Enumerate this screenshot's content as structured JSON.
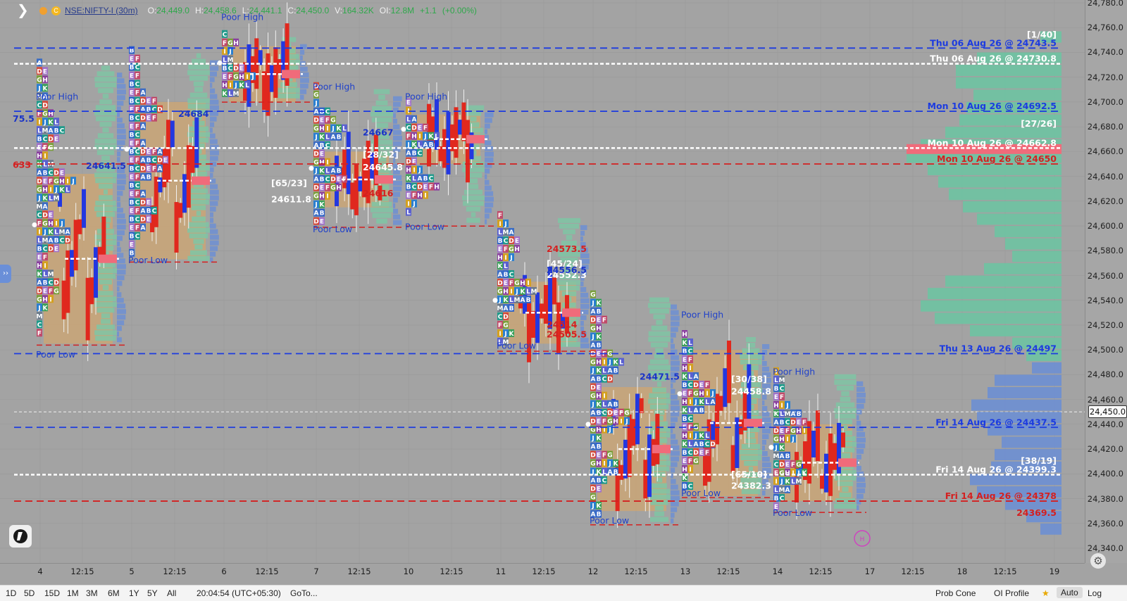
{
  "header": {
    "symbol": "NSE:NIFTY-I (30m)",
    "ohlc": [
      {
        "k": "O:",
        "v": "24,449.0"
      },
      {
        "k": "H:",
        "v": "24,458.6"
      },
      {
        "k": "L:",
        "v": "24,441.1"
      },
      {
        "k": "C:",
        "v": "24,450.0"
      },
      {
        "k": "V:",
        "v": "164.32K"
      },
      {
        "k": "OI:",
        "v": "12.8M"
      },
      {
        "k": "",
        "v": "+1.1"
      },
      {
        "k": "",
        "v": "(+0.00%)"
      }
    ]
  },
  "price_axis": {
    "ticks": [
      "24,780.0",
      "24,760.0",
      "24,740.0",
      "24,720.0",
      "24,700.0",
      "24,680.0",
      "24,660.0",
      "24,640.0",
      "24,620.0",
      "24,600.0",
      "24,580.0",
      "24,560.0",
      "24,540.0",
      "24,520.0",
      "24,500.0",
      "24,480.0",
      "24,460.0",
      "24,440.0",
      "24,420.0",
      "24,400.0",
      "24,380.0",
      "24,360.0",
      "24,340.0"
    ],
    "last_price": "24,450.0"
  },
  "time_axis": {
    "labels": [
      "4",
      "12:15",
      "5",
      "12:15",
      "6",
      "12:15",
      "7",
      "12:15",
      "10",
      "12:15",
      "11",
      "12:15",
      "12",
      "12:15",
      "13",
      "12:15",
      "14",
      "12:15",
      "17",
      "12:15",
      "18",
      "12:15",
      "19"
    ]
  },
  "bottom_bar": {
    "ranges": [
      "1D",
      "5D",
      "15D",
      "1M",
      "3M",
      "6M",
      "1Y",
      "5Y",
      "All"
    ],
    "clock": "20:04:54 (UTC+05:30)",
    "goto": "GoTo...",
    "right": [
      "Prob Cone",
      "OI Profile"
    ],
    "auto": "Auto",
    "log": "Log"
  },
  "chart_data": {
    "type": "other",
    "description_free": true,
    "y_range": [
      24340,
      24780
    ],
    "ref_lines": [
      {
        "label": "Thu 06 Aug 26 @ 24743.5",
        "price": 24743.5,
        "color": "#1c3be0",
        "style": "dash"
      },
      {
        "label": "Thu 06 Aug 26 @ 24730.8",
        "price": 24730.8,
        "color": "#ffffff",
        "style": "dot"
      },
      {
        "label": "Mon 10 Aug 26 @ 24692.5",
        "price": 24692.5,
        "color": "#1c3be0",
        "style": "dash"
      },
      {
        "label": "Mon 10 Aug 26 @ 24662.8",
        "price": 24662.8,
        "color": "#ffffff",
        "style": "dot"
      },
      {
        "label": "Mon 10 Aug 26 @ 24650",
        "price": 24650,
        "color": "#d42020",
        "style": "dash"
      },
      {
        "label": "Thu 13 Aug 26 @ 24497",
        "price": 24497,
        "color": "#1c3be0",
        "style": "dash"
      },
      {
        "label": "Fri 14 Aug 26 @ 24437.5",
        "price": 24437.5,
        "color": "#1c3be0",
        "style": "dash"
      },
      {
        "label": "Fri 14 Aug 26 @ 24399.3",
        "price": 24399.3,
        "color": "#ffffff",
        "style": "dot"
      },
      {
        "label": "Fri 14 Aug 26 @ 24378",
        "price": 24378,
        "color": "#d42020",
        "style": "dash"
      }
    ],
    "tags": [
      "[1/40]",
      "[27/26]",
      "[38/19]"
    ],
    "side_price": "24369.5",
    "annotations": [
      {
        "t": "Poor High",
        "price": 24702,
        "day": 0,
        "color": "#2142c9"
      },
      {
        "t": "Poor Low",
        "price": 24494,
        "day": 0,
        "color": "#2142c9"
      },
      {
        "t": "24641.5",
        "price": 24646,
        "day": 0,
        "color": "#1a34c8"
      },
      {
        "t": "24684",
        "price": 24688,
        "day": 1,
        "color": "#1a34c8"
      },
      {
        "t": "Poor Low",
        "price": 24570,
        "day": 1,
        "color": "#2142c9"
      },
      {
        "t": "Poor High",
        "price": 24766,
        "day": 2,
        "color": "#2142c9"
      },
      {
        "t": "[65/23]",
        "price": 24632,
        "day": 2,
        "color": "#ffffff"
      },
      {
        "t": "24611.8",
        "price": 24619,
        "day": 2,
        "color": "#ffffff"
      },
      {
        "t": "Poor High",
        "price": 24710,
        "day": 3,
        "color": "#2142c9"
      },
      {
        "t": "Poor Low",
        "price": 24595,
        "day": 3,
        "color": "#2142c9"
      },
      {
        "t": "24667",
        "price": 24673,
        "day": 3,
        "color": "#1a34c8"
      },
      {
        "t": "[28/32]",
        "price": 24655,
        "day": 3,
        "color": "#ffffff"
      },
      {
        "t": "24645.8",
        "price": 24645,
        "day": 3,
        "color": "#ffffff"
      },
      {
        "t": "24616",
        "price": 24624,
        "day": 3,
        "color": "#d42020"
      },
      {
        "t": "Poor High",
        "price": 24702,
        "day": 4,
        "color": "#2142c9"
      },
      {
        "t": "Poor Low",
        "price": 24597,
        "day": 4,
        "color": "#2142c9"
      },
      {
        "t": "24573.5",
        "price": 24579,
        "day": 5,
        "color": "#d42020"
      },
      {
        "t": "[45/24]",
        "price": 24567,
        "day": 5,
        "color": "#ffffff"
      },
      {
        "t": "24552.3",
        "price": 24558,
        "day": 5,
        "color": "#ffffff"
      },
      {
        "t": "24556.5",
        "price": 24562,
        "day": 5,
        "color": "#1a34c8"
      },
      {
        "t": "Poor Low",
        "price": 24501,
        "day": 5,
        "color": "#2142c9"
      },
      {
        "t": "24514",
        "price": 24518,
        "day": 5,
        "color": "#d42020"
      },
      {
        "t": "24505.5",
        "price": 24510,
        "day": 5,
        "color": "#d42020"
      },
      {
        "t": "24471.5",
        "price": 24476,
        "day": 6,
        "color": "#1a34c8"
      },
      {
        "t": "Poor Low",
        "price": 24360,
        "day": 6,
        "color": "#2142c9"
      },
      {
        "t": "Poor High",
        "price": 24526,
        "day": 7,
        "color": "#2142c9"
      },
      {
        "t": "[30/38]",
        "price": 24474,
        "day": 7,
        "color": "#ffffff"
      },
      {
        "t": "24458.8",
        "price": 24464,
        "day": 7,
        "color": "#ffffff"
      },
      {
        "t": "[65/10]",
        "price": 24397,
        "day": 7,
        "color": "#ffffff"
      },
      {
        "t": "24382.3",
        "price": 24388,
        "day": 7,
        "color": "#ffffff"
      },
      {
        "t": "Poor Low",
        "price": 24382,
        "day": 7,
        "color": "#2142c9"
      },
      {
        "t": "Poor High",
        "price": 24480,
        "day": 8,
        "color": "#2142c9"
      },
      {
        "t": "Poor Low",
        "price": 24366,
        "day": 8,
        "color": "#2142c9"
      },
      {
        "t": "75.5",
        "price": 24684,
        "day": -1,
        "color": "#1a34c8"
      },
      {
        "t": "633",
        "price": 24647,
        "day": -1,
        "color": "#d42020"
      }
    ],
    "colors": {
      "bg": "#a3a3a3",
      "tan": "#c8a579",
      "green": "#7fc6a4",
      "blue": "#6b8fd6",
      "red_candle": "#e0281e",
      "blue_candle": "#2338e0",
      "teal_profile": "#6ec3a2",
      "blue_profile": "#6d8fd3",
      "hvn": "#f06b7a"
    }
  }
}
